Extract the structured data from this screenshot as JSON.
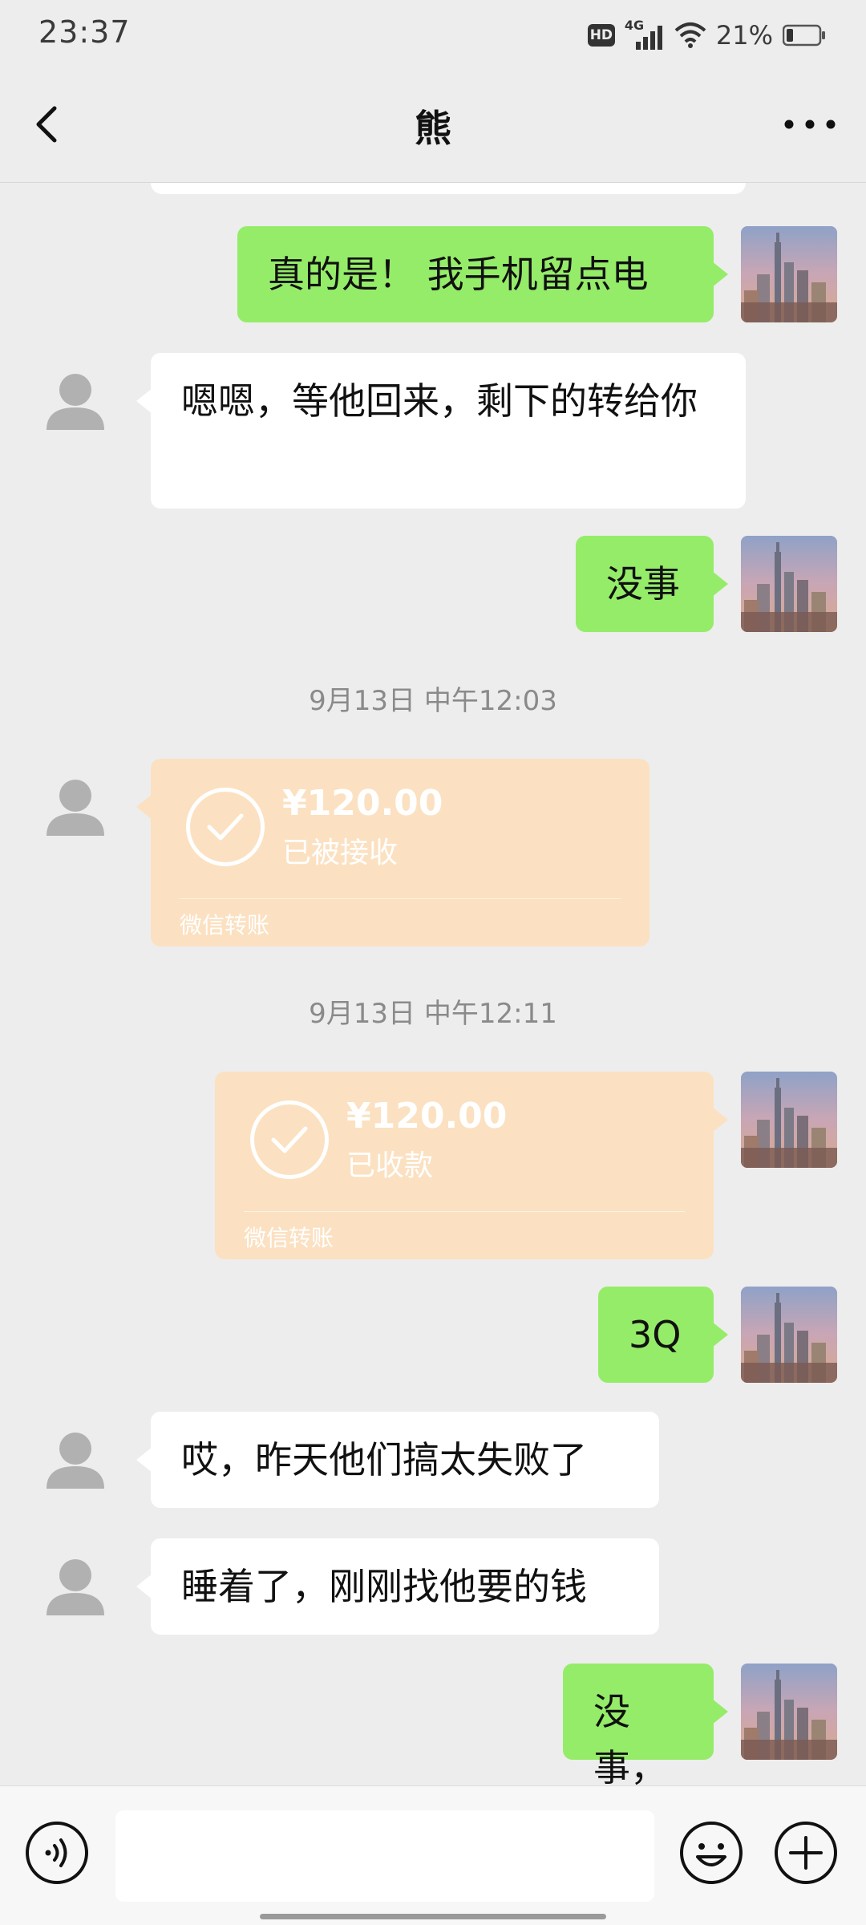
{
  "status_bar": {
    "time": "23:37",
    "hd_label": "HD",
    "network": "4G",
    "battery": "21%"
  },
  "header": {
    "title": "熊"
  },
  "messages": [
    {
      "id": "m1",
      "side": "out",
      "text": "真的是！ 我手机留点电"
    },
    {
      "id": "m2",
      "side": "in",
      "text": "嗯嗯，等他回来，剩下的转给你"
    },
    {
      "id": "m3",
      "side": "out",
      "text": "没事"
    },
    {
      "id": "t1",
      "type": "timestamp",
      "text": "9月13日 中午12:03"
    },
    {
      "id": "tr1",
      "side": "in",
      "type": "transfer",
      "amount": "¥120.00",
      "status": "已被接收",
      "label": "微信转账"
    },
    {
      "id": "t2",
      "type": "timestamp",
      "text": "9月13日 中午12:11"
    },
    {
      "id": "tr2",
      "side": "out",
      "type": "transfer",
      "amount": "¥120.00",
      "status": "已收款",
      "label": "微信转账"
    },
    {
      "id": "m4",
      "side": "out",
      "text": "3Q"
    },
    {
      "id": "m5",
      "side": "in",
      "text": "哎，昨天他们搞太失败了"
    },
    {
      "id": "m6",
      "side": "in",
      "text": "睡着了，刚刚找他要的钱"
    },
    {
      "id": "m7",
      "side": "out",
      "text": "没事，"
    }
  ],
  "input": {
    "value": "",
    "placeholder": ""
  },
  "icons": {
    "back": "back-arrow-icon",
    "more": "more-dots-icon",
    "voice": "voice-icon",
    "emoji": "emoji-icon",
    "plus": "plus-icon"
  },
  "colors": {
    "outgoing_bubble": "#95ec69",
    "incoming_bubble": "#ffffff",
    "transfer_card": "#fbe1c1",
    "background": "#ededed"
  }
}
